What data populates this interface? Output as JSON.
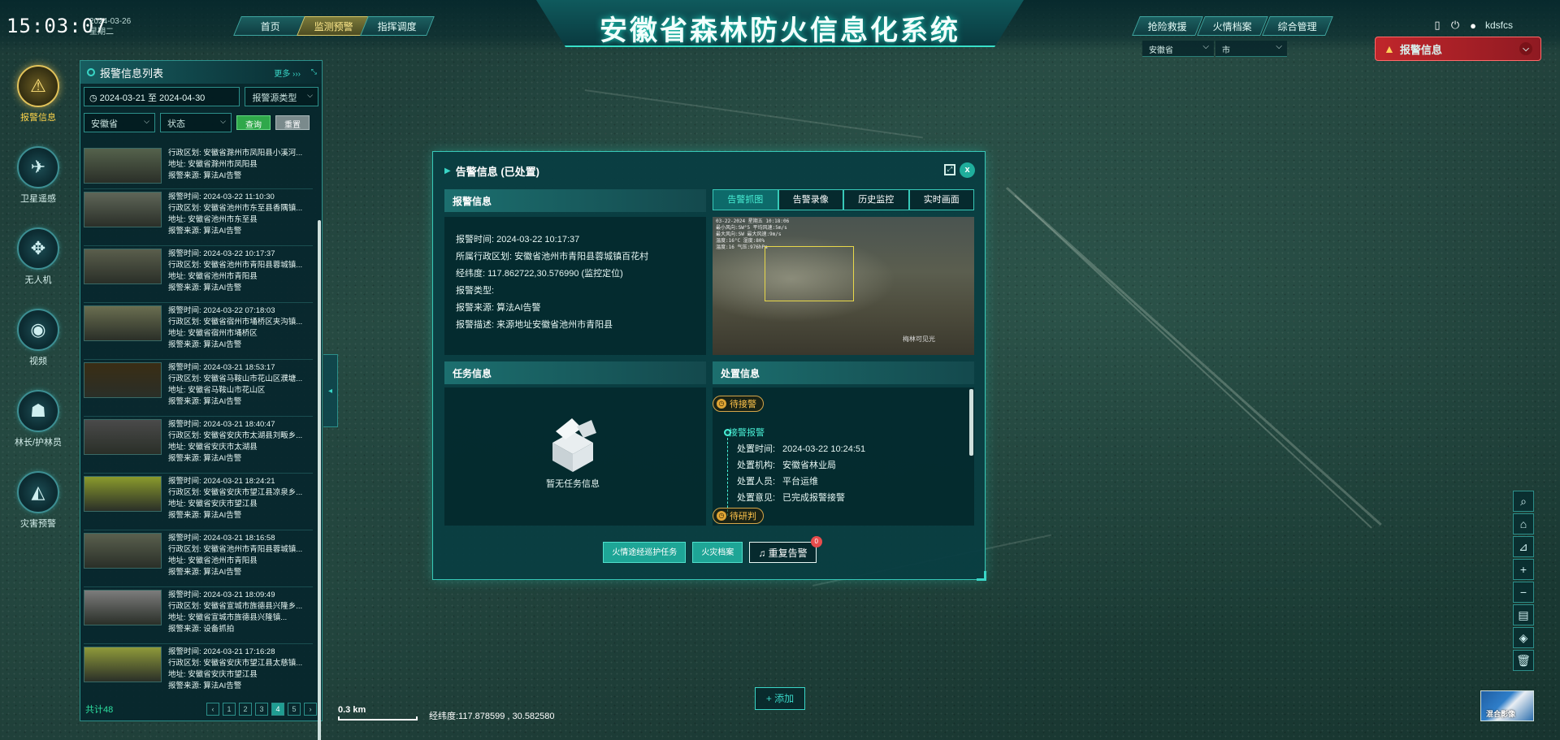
{
  "header": {
    "time": "15:03:07",
    "date": "2024-03-26",
    "weekday": "星期二",
    "title": "安徽省森林防火信息化系统",
    "nav_left": [
      {
        "label": "首页",
        "active": false
      },
      {
        "label": "监测预警",
        "active": true
      },
      {
        "label": "指挥调度",
        "active": false
      }
    ],
    "nav_right": [
      {
        "label": "抢险救援"
      },
      {
        "label": "火情档案"
      },
      {
        "label": "综合管理"
      }
    ],
    "region": {
      "province": "安徽省",
      "city": "市"
    },
    "user": "kdsfcs",
    "alarm_pill": "报警信息"
  },
  "rail": [
    {
      "label": "报警信息",
      "icon": "alarm-icon",
      "active": true
    },
    {
      "label": "卫星遥感",
      "icon": "satellite-icon",
      "active": false
    },
    {
      "label": "无人机",
      "icon": "drone-icon",
      "active": false
    },
    {
      "label": "视频",
      "icon": "camera-icon",
      "active": false
    },
    {
      "label": "林长/护林员",
      "icon": "ranger-icon",
      "active": false
    },
    {
      "label": "灾害预警",
      "icon": "disaster-warning-icon",
      "active": false
    }
  ],
  "alarm_panel": {
    "title": "报警信息列表",
    "more": "更多",
    "date_range": "2024-03-21 至 2024-04-30",
    "source_type_placeholder": "报警源类型",
    "province": "安徽省",
    "status_placeholder": "状态",
    "query": "查询",
    "reset": "重置",
    "total": "共计48",
    "pages": [
      "1",
      "2",
      "3",
      "4",
      "5"
    ],
    "current_page": "4",
    "items": [
      {
        "l1": "行政区划: 安徽省滁州市凤阳县小溪河...",
        "l2": "地址: 安徽省滁州市凤阳县",
        "l3": "报警来源: 算法AI告警",
        "thumb": "#55624c"
      },
      {
        "l0": "报警时间: 2024-03-22 11:10:30",
        "l1": "行政区划: 安徽省池州市东至县香隅镇...",
        "l2": "地址: 安徽省池州市东至县",
        "l3": "报警来源: 算法AI告警",
        "thumb": "#5f6658"
      },
      {
        "l0": "报警时间: 2024-03-22 10:17:37",
        "l1": "行政区划: 安徽省池州市青阳县蓉城镇...",
        "l2": "地址: 安徽省池州市青阳县",
        "l3": "报警来源: 算法AI告警",
        "thumb": "#5a5e4c"
      },
      {
        "l0": "报警时间: 2024-03-22 07:18:03",
        "l1": "行政区划: 安徽省宿州市埇桥区夹沟镇...",
        "l2": "地址: 安徽省宿州市埇桥区",
        "l3": "报警来源: 算法AI告警",
        "thumb": "#6a6e50"
      },
      {
        "l0": "报警时间: 2024-03-21 18:53:17",
        "l1": "行政区划: 安徽省马鞍山市花山区濮塘...",
        "l2": "地址: 安徽省马鞍山市花山区",
        "l3": "报警来源: 算法AI告警",
        "thumb": "#3a2d14"
      },
      {
        "l0": "报警时间: 2024-03-21 18:40:47",
        "l1": "行政区划: 安徽省安庆市太湖县刘畈乡...",
        "l2": "地址: 安徽省安庆市太湖县",
        "l3": "报警来源: 算法AI告警",
        "thumb": "#4a4a4a"
      },
      {
        "l0": "报警时间: 2024-03-21 18:24:21",
        "l1": "行政区划: 安徽省安庆市望江县凉泉乡...",
        "l2": "地址: 安徽省安庆市望江县",
        "l3": "报警来源: 算法AI告警",
        "thumb": "#8a9a2c"
      },
      {
        "l0": "报警时间: 2024-03-21 18:16:58",
        "l1": "行政区划: 安徽省池州市青阳县蓉城镇...",
        "l2": "地址: 安徽省池州市青阳县",
        "l3": "报警来源: 算法AI告警",
        "thumb": "#5a604e"
      },
      {
        "l0": "报警时间: 2024-03-21 18:09:49",
        "l1": "行政区划: 安徽省宣城市旌德县兴隆乡...",
        "l2": "地址: 安徽省宣城市旌德县兴隆镇...",
        "l3": "报警来源: 设备抓拍",
        "thumb": "#7c7c7c"
      },
      {
        "l0": "报警时间: 2024-03-21 17:16:28",
        "l1": "行政区划: 安徽省安庆市望江县太慈镇...",
        "l2": "地址: 安徽省安庆市望江县",
        "l3": "报警来源: 算法AI告警",
        "thumb": "#8f9a3a"
      }
    ]
  },
  "modal": {
    "title": "告警信息 (已处置)",
    "alarm_section": "报警信息",
    "alarm_info": [
      "报警时间:  2024-03-22 10:17:37",
      "所属行政区划:  安徽省池州市青阳县蓉城镇百花村",
      "经纬度:  117.862722,30.576990  (监控定位)",
      "报警类型:",
      "报警来源:  算法AI告警",
      "报警描述:  来源地址安徽省池州市青阳县"
    ],
    "tabs": [
      "告警抓图",
      "告警录像",
      "历史监控",
      "实时画面"
    ],
    "active_tab": "告警抓图",
    "snapshot_watermark": "梅林可见光",
    "task_section": "任务信息",
    "task_empty": "暂无任务信息",
    "process_section": "处置信息",
    "status_pending_receive": "待接警",
    "timeline_title": "接警报警",
    "timeline": [
      {
        "k": "处置时间:",
        "v": "2024-03-22 10:24:51"
      },
      {
        "k": "处置机构:",
        "v": "安徽省林业局"
      },
      {
        "k": "处置人员:",
        "v": "平台运维"
      },
      {
        "k": "处置意见:",
        "v": "已完成报警接警"
      }
    ],
    "status_pending_judge": "待研判",
    "buttons": {
      "patrol": "火情途经巡护任务",
      "archive": "火灾档案",
      "duplicate": "重复告警",
      "duplicate_badge": "0"
    }
  },
  "map": {
    "scale": "0.3 km",
    "coords": "经纬度:117.878599 , 30.582580",
    "add": "添加",
    "layer": "混合影像"
  }
}
